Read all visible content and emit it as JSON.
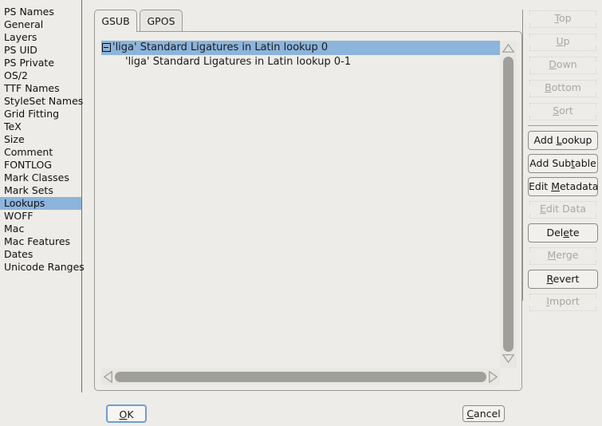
{
  "sidebar": {
    "items": [
      {
        "label": "PS Names",
        "selected": false
      },
      {
        "label": "General",
        "selected": false
      },
      {
        "label": "Layers",
        "selected": false
      },
      {
        "label": "PS UID",
        "selected": false
      },
      {
        "label": "PS Private",
        "selected": false
      },
      {
        "label": "OS/2",
        "selected": false
      },
      {
        "label": "TTF Names",
        "selected": false
      },
      {
        "label": "StyleSet Names",
        "selected": false
      },
      {
        "label": "Grid Fitting",
        "selected": false
      },
      {
        "label": "TeX",
        "selected": false
      },
      {
        "label": "Size",
        "selected": false
      },
      {
        "label": "Comment",
        "selected": false
      },
      {
        "label": "FONTLOG",
        "selected": false
      },
      {
        "label": "Mark Classes",
        "selected": false
      },
      {
        "label": "Mark Sets",
        "selected": false
      },
      {
        "label": "Lookups",
        "selected": true
      },
      {
        "label": "WOFF",
        "selected": false
      },
      {
        "label": "Mac",
        "selected": false
      },
      {
        "label": "Mac Features",
        "selected": false
      },
      {
        "label": "Dates",
        "selected": false
      },
      {
        "label": "Unicode Ranges",
        "selected": false
      }
    ]
  },
  "tabs": [
    {
      "label": "GSUB",
      "active": true
    },
    {
      "label": "GPOS",
      "active": false
    }
  ],
  "tree": {
    "root": {
      "label": "'liga' Standard Ligatures in Latin lookup 0",
      "expanded": true,
      "selected": true,
      "expander_glyph": "minus"
    },
    "child": {
      "label": "'liga' Standard Ligatures in Latin lookup 0-1",
      "selected": false
    }
  },
  "buttons": {
    "right": [
      {
        "label": "Top",
        "mnemonic": "T",
        "enabled": false
      },
      {
        "label": "Up",
        "mnemonic": "U",
        "enabled": false
      },
      {
        "label": "Down",
        "mnemonic": "D",
        "enabled": false
      },
      {
        "label": "Bottom",
        "mnemonic": "B",
        "enabled": false
      },
      {
        "label": "Sort",
        "mnemonic": "S",
        "enabled": false
      },
      {
        "label": "Add Lookup",
        "mnemonic": "L",
        "enabled": true
      },
      {
        "label": "Add Subtable",
        "mnemonic": "t",
        "enabled": true
      },
      {
        "label": "Edit Metadata",
        "mnemonic": "M",
        "enabled": true
      },
      {
        "label": "Edit Data",
        "mnemonic": "E",
        "enabled": false
      },
      {
        "label": "Delete",
        "mnemonic": "e",
        "enabled": true
      },
      {
        "label": "Merge",
        "mnemonic": "M",
        "enabled": false
      },
      {
        "label": "Revert",
        "mnemonic": "R",
        "enabled": true
      },
      {
        "label": "Import",
        "mnemonic": "I",
        "enabled": false
      }
    ],
    "ok": "OK",
    "cancel": "Cancel"
  },
  "colors": {
    "background": "#edece8",
    "selection": "#8cb4dc",
    "scrollbar_thumb": "#a0a09a",
    "default_button_focus": "#6f9ed0",
    "annotation": "#ff0000"
  },
  "scrollbars": {
    "vertical": {
      "thumb_position_percent": 4,
      "thumb_size_percent": 90
    },
    "horizontal": {
      "thumb_position_percent": 0,
      "thumb_size_percent": 97
    }
  }
}
